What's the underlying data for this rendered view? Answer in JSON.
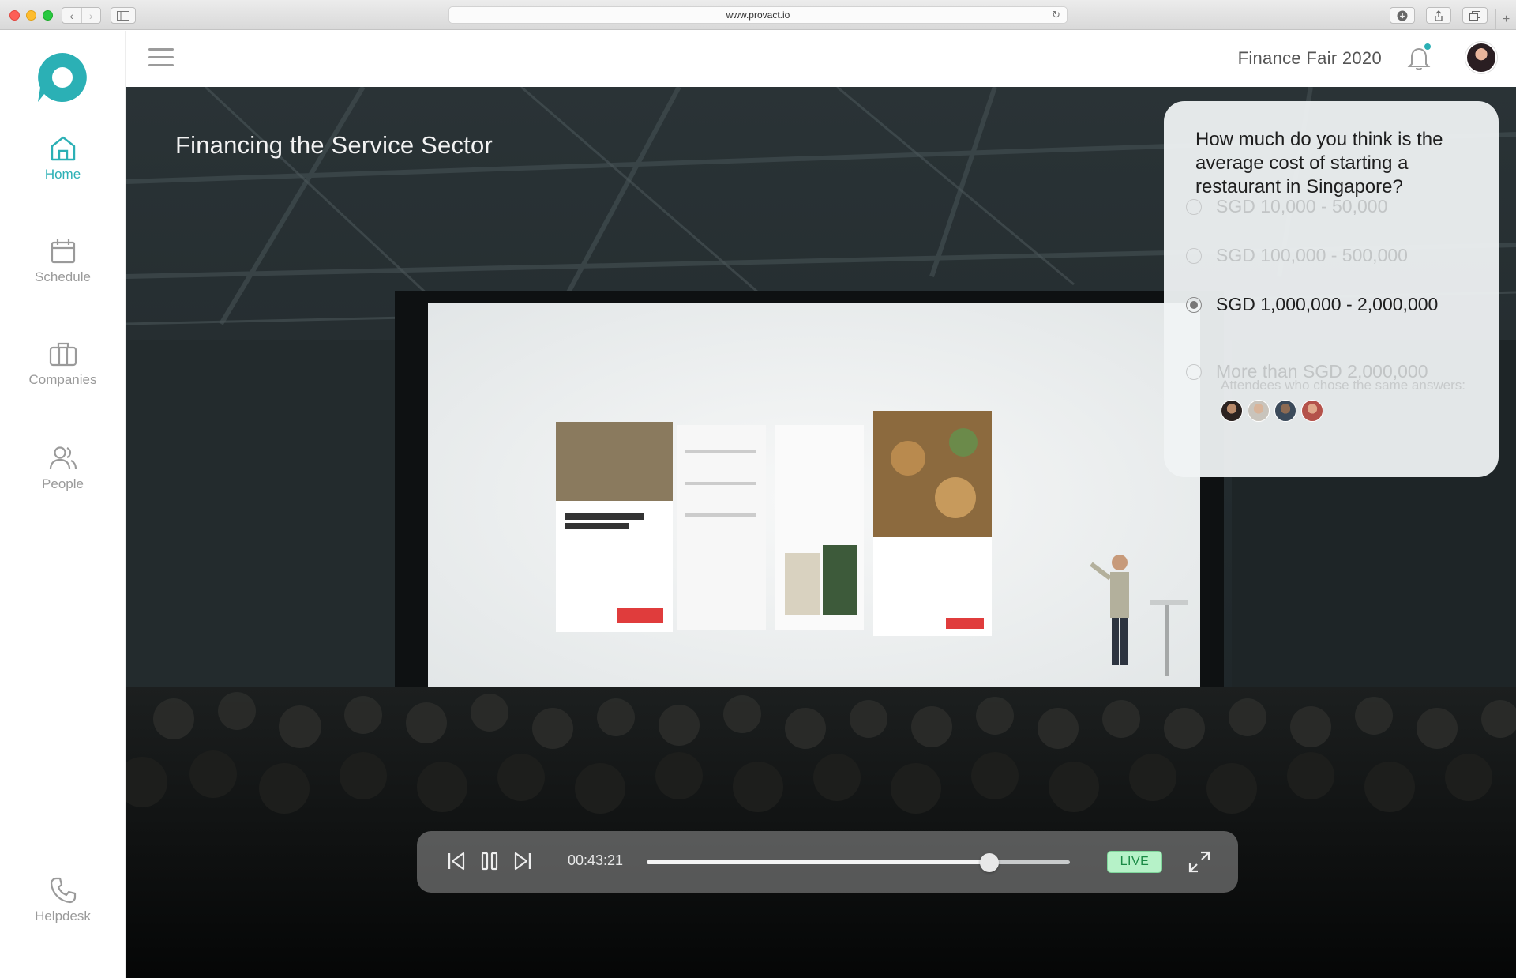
{
  "browser": {
    "url": "www.provact.io"
  },
  "sidebar": {
    "items": [
      {
        "label": "Home",
        "icon": "home-icon",
        "active": true
      },
      {
        "label": "Schedule",
        "icon": "calendar-icon",
        "active": false
      },
      {
        "label": "Companies",
        "icon": "briefcase-icon",
        "active": false
      },
      {
        "label": "People",
        "icon": "people-icon",
        "active": false
      },
      {
        "label": "Helpdesk",
        "icon": "phone-icon",
        "active": false
      }
    ]
  },
  "header": {
    "event_title": "Finance Fair 2020"
  },
  "stage": {
    "session_title": "Financing the Service Sector"
  },
  "poll": {
    "question": "How much do you think is the average cost of starting a restaurant in Singapore?",
    "options": [
      {
        "label": "SGD 10,000 - 50,000",
        "selected": false
      },
      {
        "label": "SGD 100,000 - 500,000",
        "selected": false
      },
      {
        "label": "SGD 1,000,000 - 2,000,000",
        "selected": true
      },
      {
        "label": "More than SGD 2,000,000",
        "selected": false
      }
    ],
    "attendees_note": "Attendees who chose the same answers:"
  },
  "player": {
    "time": "00:43:21",
    "progress": 0.81,
    "live_label": "LIVE"
  },
  "colors": {
    "accent": "#2bb0b5",
    "live_bg": "#b6f2c8"
  }
}
